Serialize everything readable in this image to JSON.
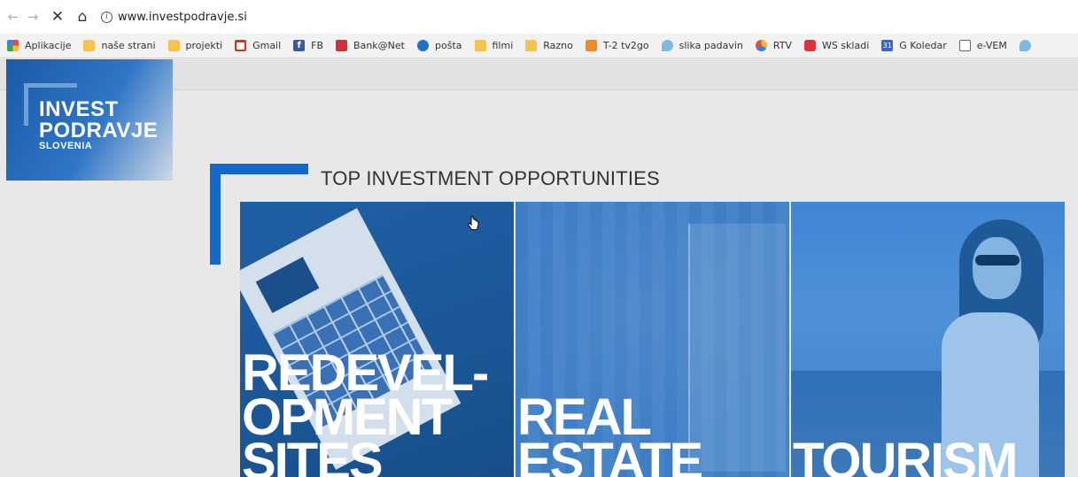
{
  "browser": {
    "url": "www.investpodravje.si",
    "bookmarks": [
      {
        "label": "Aplikacije",
        "icon": "apps-icon"
      },
      {
        "label": "naše strani",
        "icon": "folder-icon"
      },
      {
        "label": "projekti",
        "icon": "folder-icon"
      },
      {
        "label": "Gmail",
        "icon": "gmail-icon"
      },
      {
        "label": "FB",
        "icon": "facebook-icon"
      },
      {
        "label": "Bank@Net",
        "icon": "bank-icon"
      },
      {
        "label": "pošta",
        "icon": "mail-icon"
      },
      {
        "label": "filmi",
        "icon": "folder-icon"
      },
      {
        "label": "Razno",
        "icon": "folder-icon"
      },
      {
        "label": "T-2 tv2go",
        "icon": "tv-icon"
      },
      {
        "label": "slika padavin",
        "icon": "rain-icon"
      },
      {
        "label": "RTV",
        "icon": "rtv-icon"
      },
      {
        "label": "WS skladi",
        "icon": "ws-icon"
      },
      {
        "label": "G Koledar",
        "icon": "calendar-icon"
      },
      {
        "label": "e-VEM",
        "icon": "document-icon"
      }
    ]
  },
  "logo": {
    "line1": "INVEST",
    "line2": "PODRAVJE",
    "line3": "SLOVENIA"
  },
  "section_title": "TOP INVESTMENT OPPORTUNITIES",
  "tiles": [
    {
      "caption_lines": [
        "REDEVEL-",
        "OPMENT",
        "SITES"
      ]
    },
    {
      "caption_lines": [
        "REAL",
        "ESTATE"
      ]
    },
    {
      "caption_lines": [
        "TOURISM"
      ]
    }
  ],
  "colors": {
    "brand_blue": "#1468c8",
    "page_bg": "#e8e8e8"
  }
}
